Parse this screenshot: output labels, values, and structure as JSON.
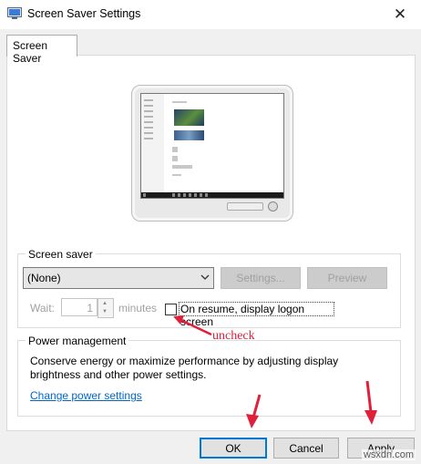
{
  "window": {
    "title": "Screen Saver Settings",
    "close_icon": "close-icon",
    "app_icon": "screen-saver-app-icon"
  },
  "tabs": [
    {
      "label": "Screen Saver",
      "selected": true
    }
  ],
  "screen_saver": {
    "group_label": "Screen saver",
    "selected_option": "(None)",
    "settings_label": "Settings...",
    "preview_label": "Preview",
    "wait_label": "Wait:",
    "wait_value": "1",
    "minutes_label": "minutes",
    "resume_label": "On resume, display logon screen",
    "resume_checked": false
  },
  "power": {
    "group_label": "Power management",
    "description_1": "Conserve energy or maximize performance by adjusting display",
    "description_2": "brightness and other power settings.",
    "link_label": "Change power settings"
  },
  "annotation": {
    "text": "uncheck",
    "color": "#e0203a"
  },
  "footer": {
    "ok_label": "OK",
    "cancel_label": "Cancel",
    "apply_label": "Apply"
  },
  "watermark": "wsxdn.com",
  "colors": {
    "accent": "#0078d7",
    "link": "#0066cc",
    "annotation_red": "#e0203a"
  }
}
